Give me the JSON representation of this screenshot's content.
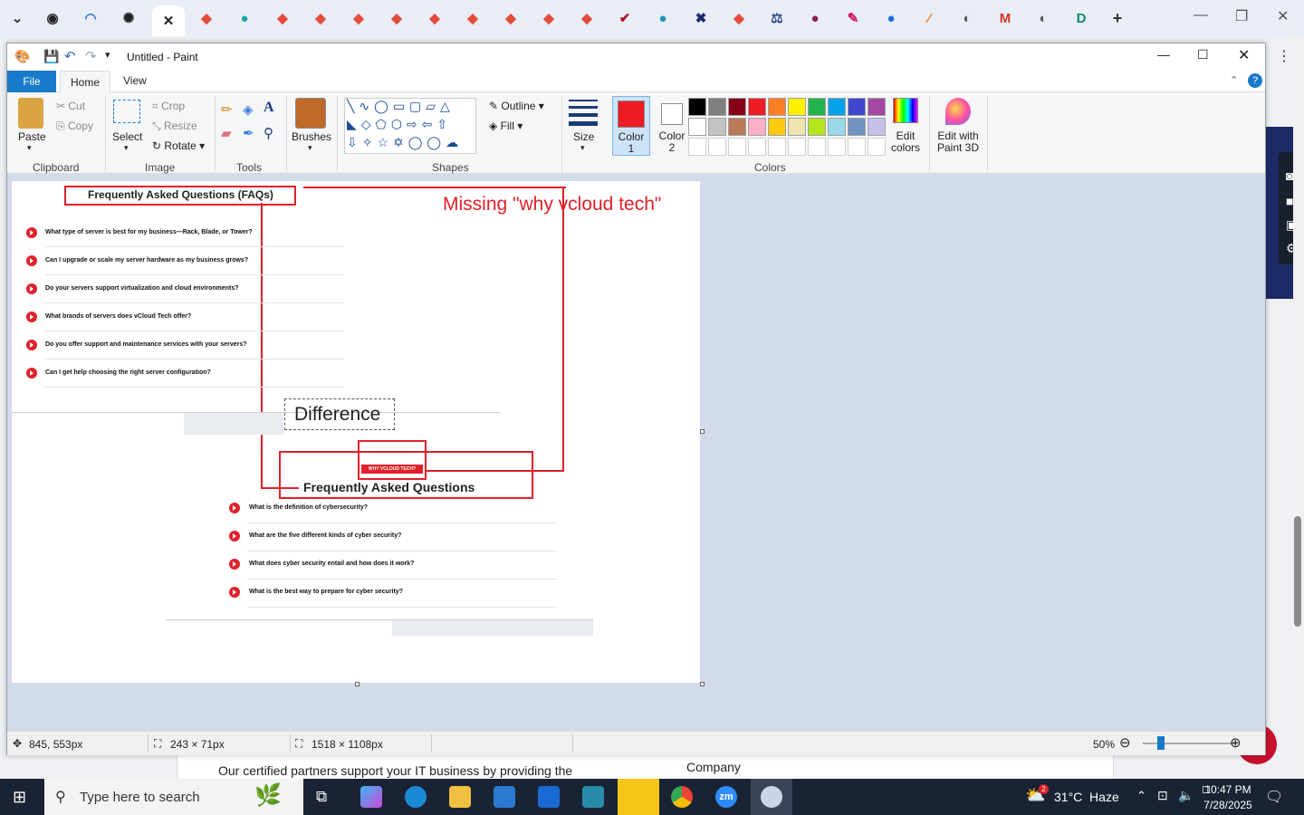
{
  "paint": {
    "title": "Untitled - Paint",
    "tabs": [
      "File",
      "Home",
      "View"
    ],
    "clipboard": {
      "paste": "Paste",
      "cut": "Cut",
      "copy": "Copy",
      "group": "Clipboard"
    },
    "image": {
      "select": "Select",
      "crop": "Crop",
      "resize": "Resize",
      "rotate": "Rotate",
      "group": "Image"
    },
    "tools": {
      "group": "Tools"
    },
    "brushes": "Brushes",
    "shapes": {
      "outline": "Outline",
      "fill": "Fill",
      "group": "Shapes"
    },
    "size": "Size",
    "color1": "Color\n1",
    "color1_a": "Color",
    "color1_b": "1",
    "color2_a": "Color",
    "color2_b": "2",
    "colors_group": "Colors",
    "edit_colors_a": "Edit",
    "edit_colors_b": "colors",
    "paint3d_a": "Edit with",
    "paint3d_b": "Paint 3D",
    "palette_row1": [
      "#000000",
      "#7f7f7f",
      "#880015",
      "#ed1c24",
      "#ff7f27",
      "#fff200",
      "#22b14c",
      "#00a2e8",
      "#3f48cc",
      "#a349a4"
    ],
    "palette_row2": [
      "#ffffff",
      "#c3c3c3",
      "#b97a57",
      "#ffaec9",
      "#ffc90e",
      "#efe4b0",
      "#b5e61d",
      "#99d9ea",
      "#7092be",
      "#c8bfe7"
    ],
    "primary_color": "#ed1c24",
    "status": {
      "cursor": "845, 553px",
      "selection": "243 × 71px",
      "canvas": "1518 × 1108px",
      "zoom": "50%"
    }
  },
  "canvas": {
    "faq_title": "Frequently Asked Questions (FAQs)",
    "annotation": "Missing \"why vcloud tech\"",
    "faq_items_top": [
      "What type of server is best for my business—Rack, Blade, or Tower?",
      "Can I upgrade or scale my server hardware as my business grows?",
      "Do your servers support virtualization and cloud environments?",
      "What brands of servers does vCloud Tech offer?",
      "Do you offer support and maintenance services with your servers?",
      "Can I get help choosing the right server configuration?"
    ],
    "difference": "Difference",
    "why_badge": "WHY VCLOUD TECH?",
    "faq_title2": "Frequently Asked Questions",
    "faq_items_bottom": [
      "What is the definition of cybersecurity?",
      "What are the five different kinds of cyber security?",
      "What does cyber security entail and how does it work?",
      "What is the best way to prepare for cyber security?"
    ]
  },
  "background_page": {
    "partners_text": "Our certified partners support your IT business by providing the",
    "company": "Company"
  },
  "taskbar": {
    "search_placeholder": "Type here to search",
    "weather": "31°C  Haze",
    "weather_badge": "2",
    "time": "10:47 PM",
    "date": "7/28/2025"
  }
}
